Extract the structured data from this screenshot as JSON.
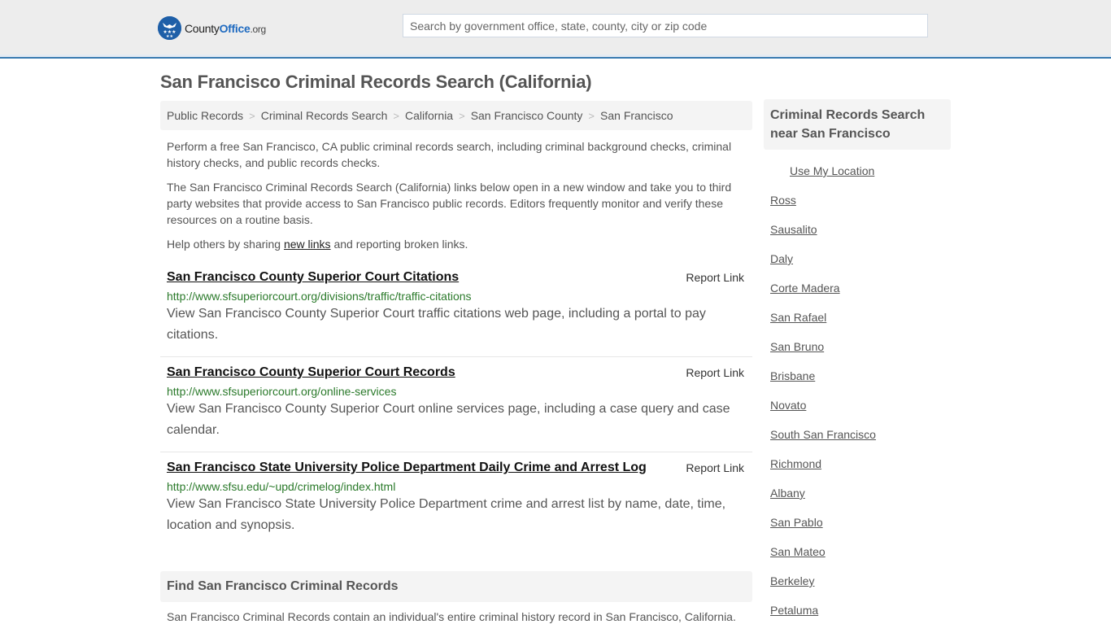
{
  "header": {
    "logo": {
      "name_part1": "County",
      "name_part2": "Office",
      "name_part3": ".org"
    },
    "search": {
      "placeholder": "Search by government office, state, county, city or zip code",
      "value": ""
    },
    "accent_color": "#3a7bb0"
  },
  "page": {
    "title": "San Francisco Criminal Records Search (California)"
  },
  "breadcrumb": [
    {
      "label": "Public Records"
    },
    {
      "label": "Criminal Records Search"
    },
    {
      "label": "California"
    },
    {
      "label": "San Francisco County"
    },
    {
      "label": "San Francisco"
    }
  ],
  "intro": {
    "p1": "Perform a free San Francisco, CA public criminal records search, including criminal background checks, criminal history checks, and public records checks.",
    "p2": "The San Francisco Criminal Records Search (California) links below open in a new window and take you to third party websites that provide access to San Francisco public records. Editors frequently monitor and verify these resources on a routine basis.",
    "p3_before": "Help others by sharing ",
    "p3_link": "new links",
    "p3_after": " and reporting broken links."
  },
  "links": [
    {
      "title": "San Francisco County Superior Court Citations",
      "report": "Report Link",
      "url": "http://www.sfsuperiorcourt.org/divisions/traffic/traffic-citations",
      "description": "View San Francisco County Superior Court traffic citations web page, including a portal to pay citations."
    },
    {
      "title": "San Francisco County Superior Court Records",
      "report": "Report Link",
      "url": "http://www.sfsuperiorcourt.org/online-services",
      "description": "View San Francisco County Superior Court online services page, including a case query and case calendar."
    },
    {
      "title": "San Francisco State University Police Department Daily Crime and Arrest Log",
      "report": "Report Link",
      "url": "http://www.sfsu.edu/~upd/crimelog/index.html",
      "description": "View San Francisco State University Police Department crime and arrest list by name, date, time, location and synopsis."
    }
  ],
  "find": {
    "heading": "Find San Francisco Criminal Records",
    "text": "San Francisco Criminal Records contain an individual's entire criminal history record in San Francisco, California."
  },
  "sidebar": {
    "heading": "Criminal Records Search near San Francisco",
    "use_location": "Use My Location",
    "nearby": [
      "Ross",
      "Sausalito",
      "Daly",
      "Corte Madera",
      "San Rafael",
      "San Bruno",
      "Brisbane",
      "Novato",
      "South San Francisco",
      "Richmond",
      "Albany",
      "San Pablo",
      "San Mateo",
      "Berkeley",
      "Petaluma"
    ]
  }
}
